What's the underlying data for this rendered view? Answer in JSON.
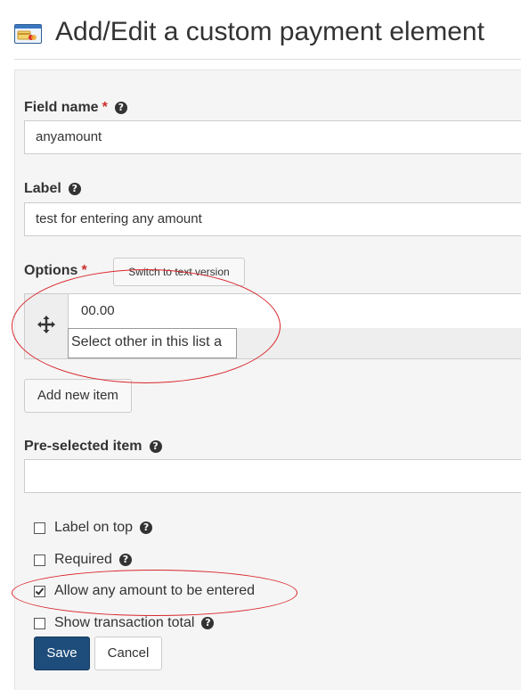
{
  "header": {
    "title": "Add/Edit a custom payment element",
    "icon": "payment-form-icon"
  },
  "form": {
    "field_name": {
      "label": "Field name",
      "required_mark": "*",
      "value": "anyamount"
    },
    "label_field": {
      "label": "Label",
      "value": "test for entering any amount"
    },
    "options": {
      "label": "Options",
      "required_mark": "*",
      "switch_button": "Switch to text version",
      "items": [
        {
          "value": "00.00",
          "text": "Select other in this list a"
        }
      ],
      "add_button": "Add new item"
    },
    "preselected": {
      "label": "Pre-selected item",
      "value": ""
    },
    "checkboxes": [
      {
        "label": "Label on top",
        "checked": false,
        "help": true
      },
      {
        "label": "Required",
        "checked": false,
        "help": true
      },
      {
        "label": "Allow any amount to be entered",
        "checked": true,
        "help": false
      },
      {
        "label": "Show transaction total",
        "checked": false,
        "help": true
      }
    ],
    "actions": {
      "save": "Save",
      "cancel": "Cancel"
    }
  },
  "colors": {
    "primary_button": "#1e4d7b",
    "required": "#c9302c",
    "annotation": "#d9262c",
    "panel": "#f5f5f5"
  }
}
